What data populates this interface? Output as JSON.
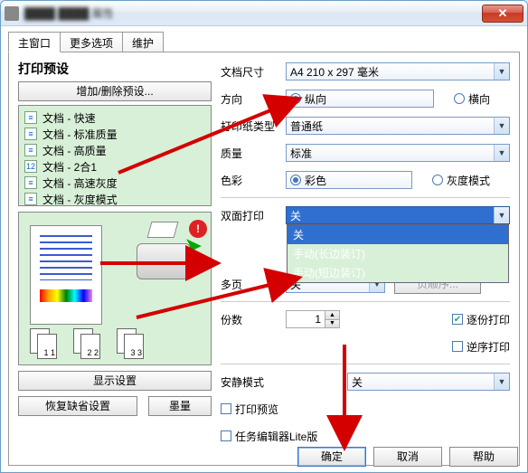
{
  "window": {
    "title": "████ ████ 属性"
  },
  "titlebar": {
    "close": "✕"
  },
  "tabs": {
    "main": "主窗口",
    "more": "更多选项",
    "maint": "维护"
  },
  "leftpanel": {
    "heading": "打印预设",
    "addremove": "增加/删除预设...",
    "presets": [
      {
        "icon": "≡",
        "label": "文档 - 快速"
      },
      {
        "icon": "≡",
        "label": "文档 - 标准质量"
      },
      {
        "icon": "≡",
        "label": "文档 - 高质量"
      },
      {
        "icon": "12",
        "label": "文档 - 2合1"
      },
      {
        "icon": "≡",
        "label": "文档 - 高速灰度"
      },
      {
        "icon": "≡",
        "label": "文档 - 灰度模式"
      }
    ],
    "showsettings": "显示设置",
    "restore": "恢复缺省设置",
    "ink": "墨量"
  },
  "form": {
    "docsize_label": "文档尺寸",
    "docsize_value": "A4 210 x 297 毫米",
    "orient_label": "方向",
    "orient_portrait": "纵向",
    "orient_landscape": "横向",
    "paper_label": "打印纸类型",
    "paper_value": "普通纸",
    "quality_label": "质量",
    "quality_value": "标准",
    "color_label": "色彩",
    "color_color": "彩色",
    "color_gray": "灰度模式",
    "duplex_label": "双面打印",
    "duplex_value": "关",
    "duplex_options": [
      "关",
      "手动(长边装订)",
      "手动(短边装订)"
    ],
    "multipage_label": "多页",
    "multipage_value": "关",
    "pageorder": "页顺序...",
    "copies_label": "份数",
    "copies_value": "1",
    "collate": "逐份打印",
    "reverse": "逆序打印",
    "quiet_label": "安静模式",
    "quiet_value": "关",
    "preview_chk": "打印预览",
    "lite_chk": "任务编辑器Lite版"
  },
  "footer": {
    "ok": "确定",
    "cancel": "取消",
    "help": "帮助"
  }
}
